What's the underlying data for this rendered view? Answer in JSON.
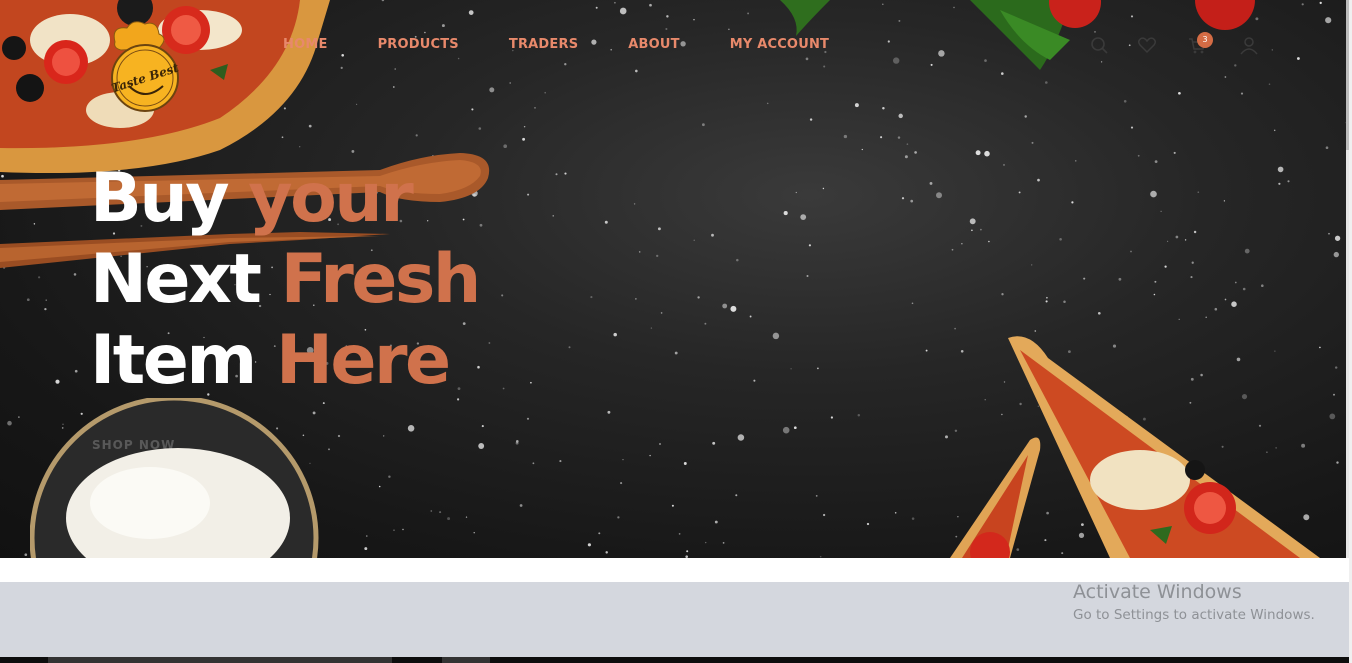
{
  "brand": {
    "logo_text": "Taste Best"
  },
  "nav": {
    "items": [
      {
        "label": "HOME",
        "name": "nav-home"
      },
      {
        "label": "PRODUCTS",
        "name": "nav-products"
      },
      {
        "label": "TRADERS",
        "name": "nav-traders"
      },
      {
        "label": "ABOUT",
        "name": "nav-about"
      },
      {
        "label": "MY ACCOUNT",
        "name": "nav-my-account"
      }
    ],
    "icons": [
      "search-icon",
      "heart-icon",
      "cart-icon",
      "user-icon"
    ],
    "cart_count": "3"
  },
  "hero": {
    "line1": {
      "white": "Buy",
      "accent": "your"
    },
    "line2": {
      "white": "Next",
      "accent": "Fresh"
    },
    "line3": {
      "white": "Item",
      "accent": "Here"
    },
    "shop_link": "SHOP NOW"
  },
  "os_watermark": {
    "title": "Activate Windows",
    "subtitle": "Go to Settings to activate Windows."
  },
  "colors": {
    "accent": "#d0724c",
    "nav_text": "#e8896b",
    "hero_bg": "#1c1c1c",
    "band_grey": "#d4d7de"
  }
}
